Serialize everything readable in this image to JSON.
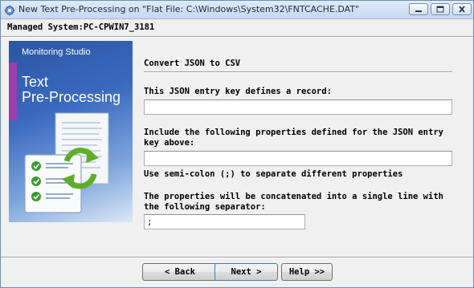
{
  "window": {
    "title": "New Text Pre-Processing on \"Flat File: C:\\Windows\\System32\\FNTCACHE.DAT\"",
    "icon": "app-gear-icon",
    "controls": [
      "minimize-icon",
      "maximize-icon",
      "close-icon"
    ]
  },
  "managed_system": "Managed System:PC-CPWIN7_3181",
  "banner": {
    "brand": "Monitoring Studio",
    "title_line1": "Text",
    "title_line2": "Pre-Processing",
    "art": "document-checklist-refresh-icon",
    "stripe_color": "#9a3fb0"
  },
  "section": {
    "heading": "Convert JSON to CSV"
  },
  "fields": {
    "record_key_label": "This JSON entry key defines a record:",
    "record_key_value": "",
    "properties_label": "Include the following properties defined for the JSON entry key above:",
    "properties_value": "",
    "properties_hint": "Use semi-colon (;) to separate different properties",
    "separator_label": "The properties will be concatenated into a single line with the following separator:",
    "separator_value": ";"
  },
  "buttons": {
    "back": "< Back",
    "next": "Next >",
    "help": "Help >>"
  }
}
